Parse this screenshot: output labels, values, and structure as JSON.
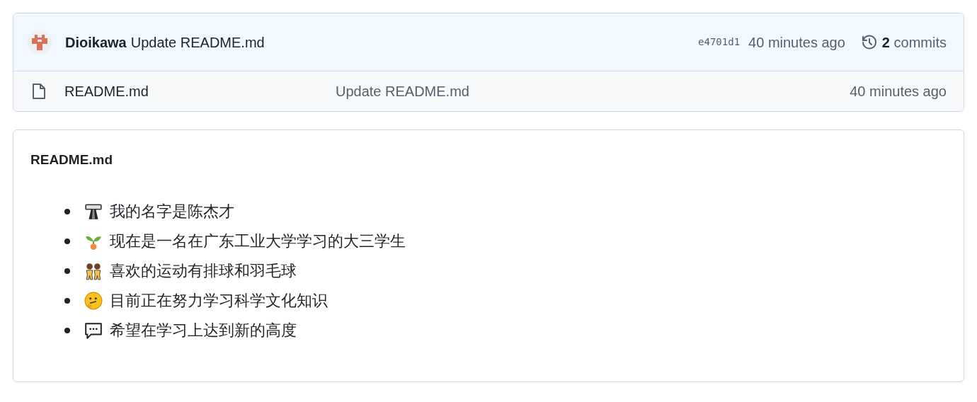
{
  "latest_commit": {
    "author": "Dioikawa",
    "message": "Update README.md",
    "hash": "e4701d1",
    "time": "40 minutes ago",
    "commit_count": "2",
    "commit_label": "commits"
  },
  "files": [
    {
      "name": "README.md",
      "message": "Update README.md",
      "time": "40 minutes ago"
    }
  ],
  "readme": {
    "title": "README.md",
    "items": [
      {
        "text": "我的名字是陈杰才"
      },
      {
        "text": "现在是一名在广东工业大学学习的大三学生"
      },
      {
        "text": "喜欢的运动有排球和羽毛球"
      },
      {
        "text": "目前正在努力学习科学文化知识"
      },
      {
        "text": "希望在学习上达到新的高度"
      }
    ]
  }
}
